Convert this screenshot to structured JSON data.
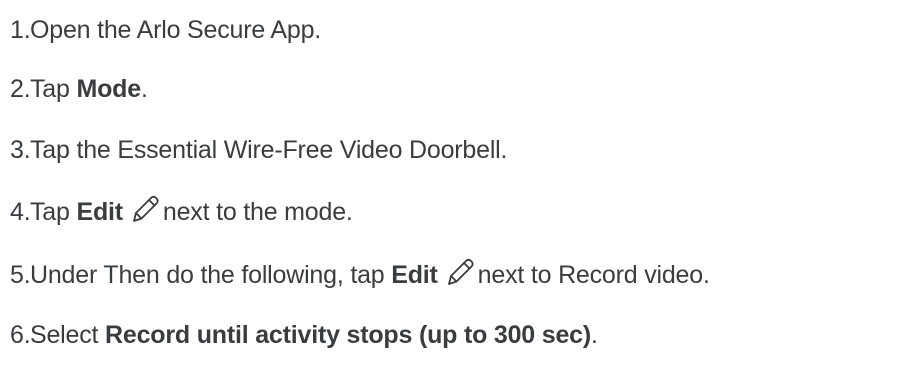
{
  "steps": [
    {
      "number": "1",
      "dot": ".",
      "text_before": "Open the Arlo Secure App."
    },
    {
      "number": "2",
      "dot": ".",
      "text_before": "Tap ",
      "bold": "Mode",
      "text_after": "."
    },
    {
      "number": "3",
      "dot": ".",
      "text_before": "Tap the Essential Wire-Free Video Doorbell."
    },
    {
      "number": "4",
      "dot": ".",
      "text_before": "Tap ",
      "bold": "Edit",
      "icon": "pencil-edit-icon",
      "text_after": "next to the mode."
    },
    {
      "number": "5",
      "dot": ".",
      "text_before": "Under Then do the following, tap ",
      "bold": "Edit",
      "icon": "pencil-edit-icon",
      "text_after": "next to Record video."
    },
    {
      "number": "6",
      "dot": ".",
      "text_before": "Select ",
      "bold": "Record until activity stops (up to 300 sec)",
      "text_after": "."
    }
  ],
  "colors": {
    "text": "#3a3d40",
    "icon": "#3a3d40"
  }
}
